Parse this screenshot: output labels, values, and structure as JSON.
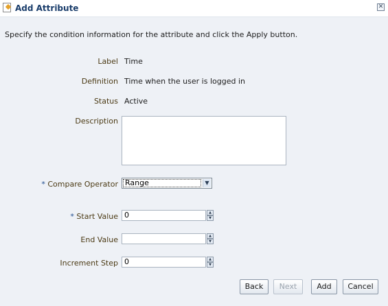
{
  "dialog": {
    "title": "Add Attribute",
    "close_glyph": "✕",
    "instructions": "Specify the condition information for the attribute and click the Apply button."
  },
  "fields": {
    "label": {
      "label": "Label",
      "value": "Time"
    },
    "definition": {
      "label": "Definition",
      "value": "Time when the user is logged in"
    },
    "status": {
      "label": "Status",
      "value": "Active"
    },
    "description": {
      "label": "Description",
      "value": ""
    },
    "compare_operator": {
      "required_mark": "*",
      "label": "Compare Operator",
      "value": "Range"
    },
    "start_value": {
      "required_mark": "*",
      "label": "Start Value",
      "value": "0"
    },
    "end_value": {
      "label": "End Value",
      "value": ""
    },
    "increment_step": {
      "label": "Increment Step",
      "value": "0"
    }
  },
  "buttons": {
    "back": "Back",
    "next": "Next",
    "add": "Add",
    "cancel": "Cancel"
  },
  "icons": {
    "title": "attribute-icon",
    "close": "close-icon",
    "dropdown": "chevron-down-icon",
    "spin_up": "spin-up-icon",
    "spin_down": "spin-down-icon"
  },
  "colors": {
    "title_text": "#1a3d6b",
    "label_text": "#4b3a14",
    "required_mark": "#1f4d8f",
    "dialog_background": "#eef1f6"
  }
}
